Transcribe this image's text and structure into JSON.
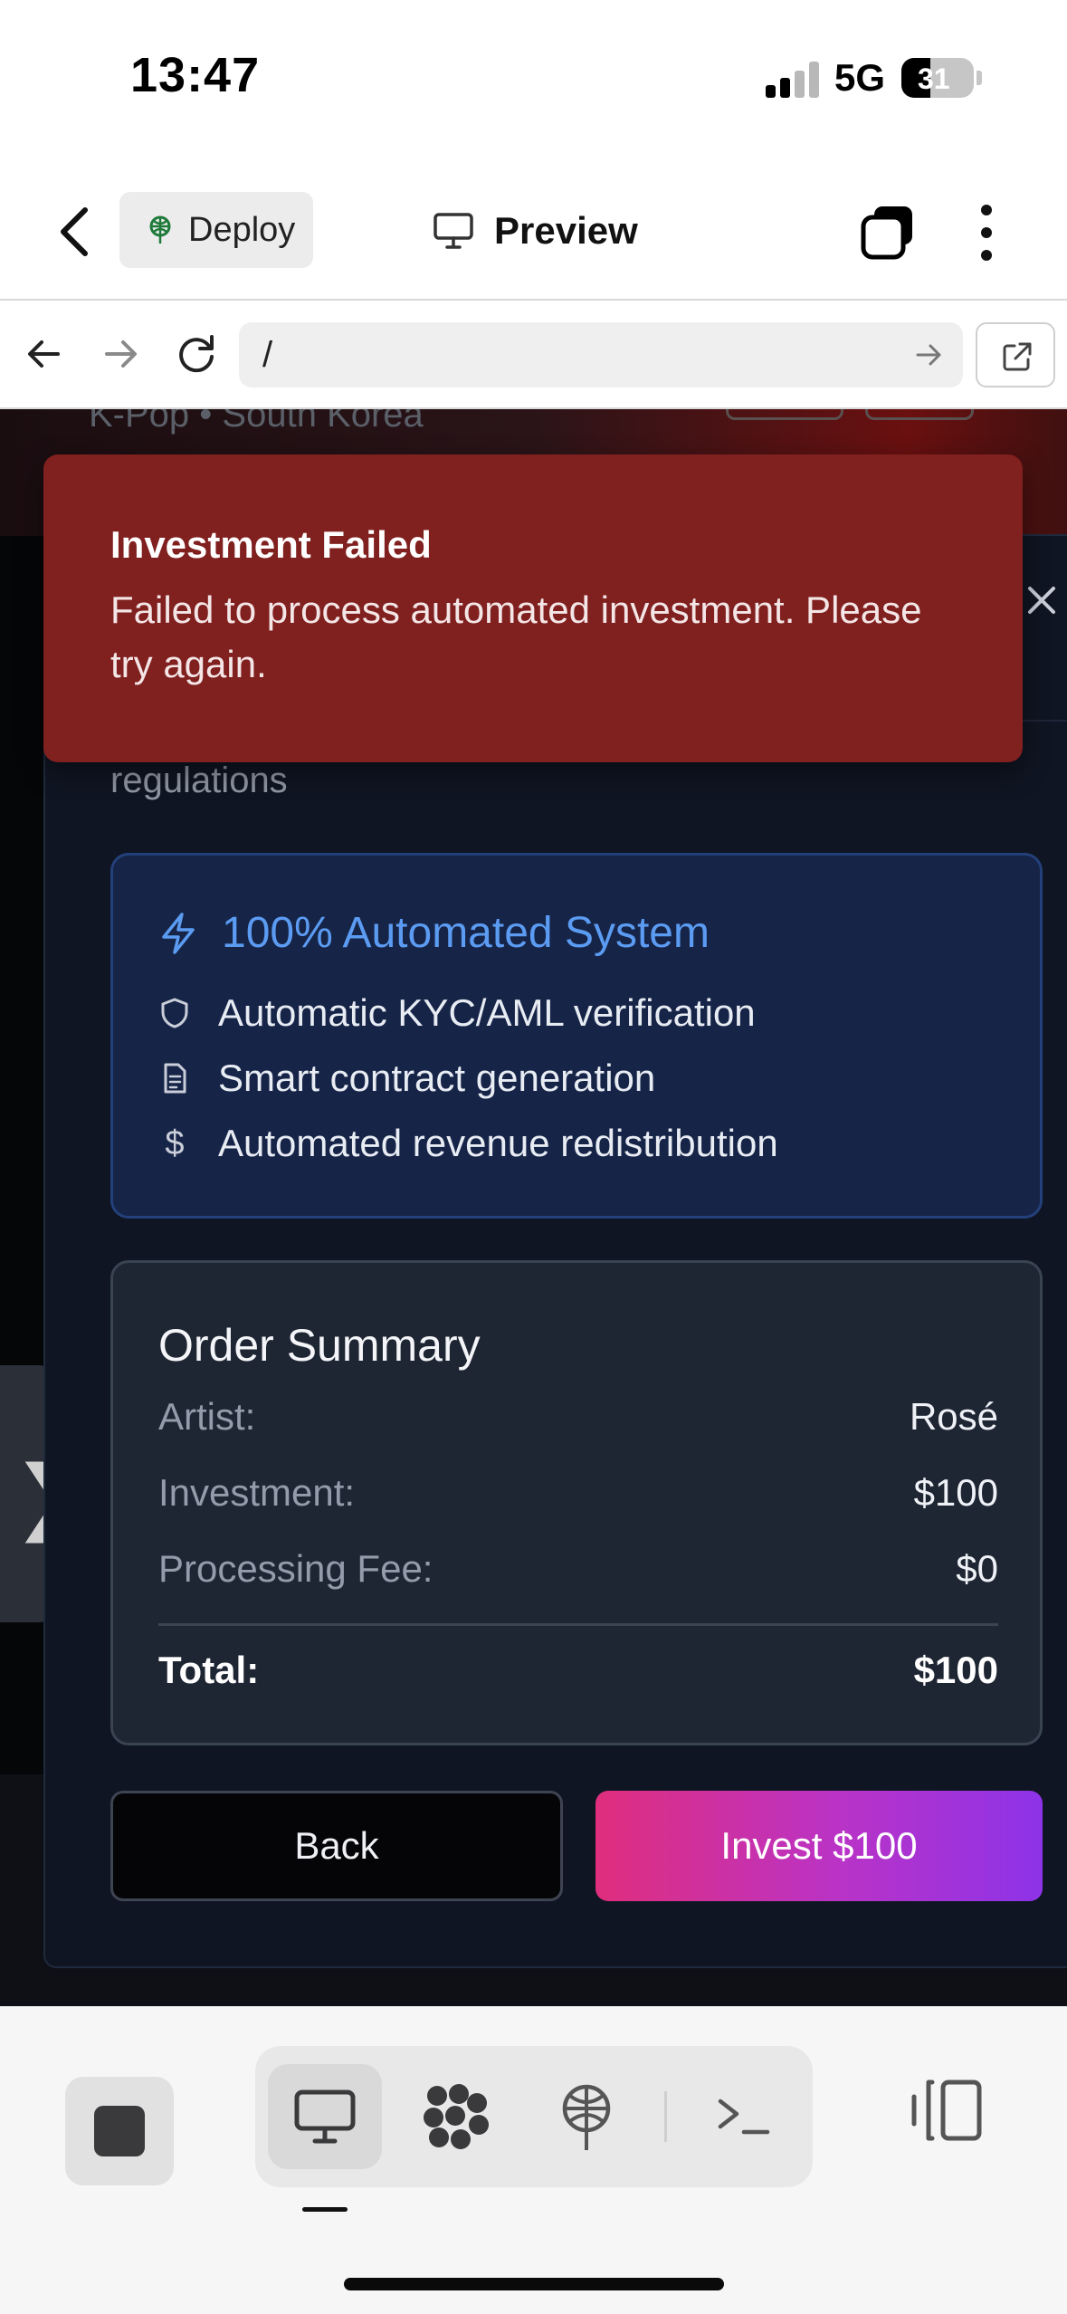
{
  "status_bar": {
    "time": "13:47",
    "network": "5G",
    "battery": "31"
  },
  "toolbar": {
    "deploy_label": "Deploy",
    "preview_label": "Preview"
  },
  "browser": {
    "url": "/"
  },
  "background": {
    "artist_meta": "K-Pop • South Korea"
  },
  "toast": {
    "title": "Investment Failed",
    "message": "Failed to process automated investment. Please try again."
  },
  "modal": {
    "regulations_text": "regulations",
    "automation": {
      "title": "100% Automated System",
      "features": [
        {
          "icon": "shield-icon",
          "label": "Automatic KYC/AML verification"
        },
        {
          "icon": "document-icon",
          "label": "Smart contract generation"
        },
        {
          "icon": "dollar-icon",
          "label": "Automated revenue redistribution"
        }
      ]
    },
    "order_summary": {
      "title": "Order Summary",
      "rows": [
        {
          "label": "Artist:",
          "value": "Rosé"
        },
        {
          "label": "Investment:",
          "value": "$100"
        },
        {
          "label": "Processing Fee:",
          "value": "$0"
        }
      ],
      "total_label": "Total:",
      "total_value": "$100"
    },
    "back_label": "Back",
    "invest_label": "Invest $100"
  },
  "colors": {
    "toast_bg": "#80201f",
    "accent_blue": "#5b9cf2",
    "invest_gradient_start": "#e02e7d",
    "invest_gradient_end": "#8d33e8",
    "modal_bg": "#0f1522"
  }
}
